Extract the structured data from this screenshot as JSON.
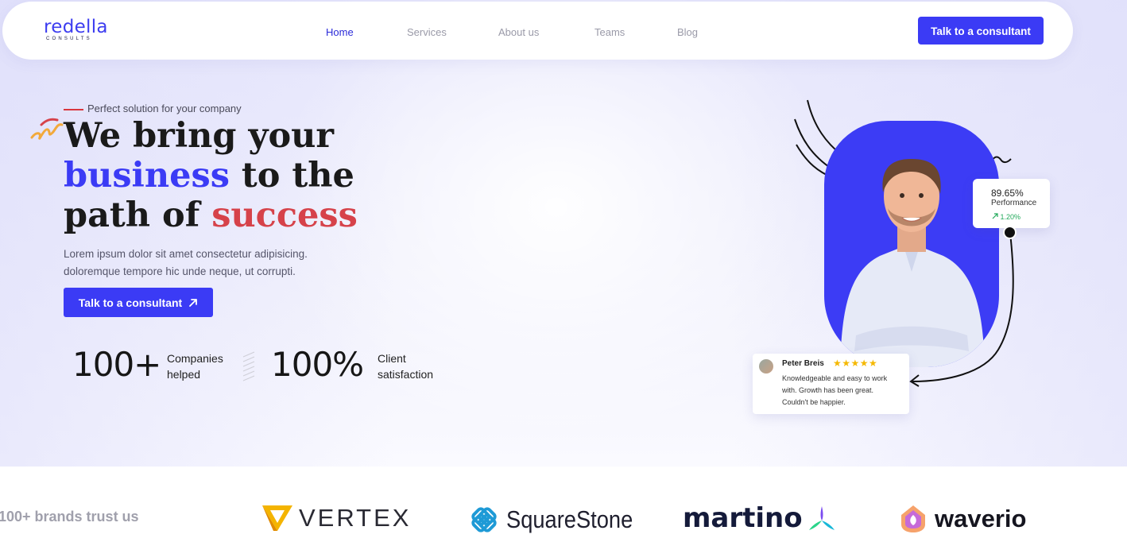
{
  "nav": {
    "logo_main": "redella",
    "logo_sub": "CONSULTS",
    "links": [
      "Home",
      "Services",
      "About us",
      "Teams",
      "Blog"
    ],
    "active": "Home",
    "cta_label": "Talk to a consultant"
  },
  "hero": {
    "tagline": "Perfect solution for your company",
    "headline_1": "We bring your",
    "headline_2_highlight": "business",
    "headline_2_rest": " to the",
    "headline_3_start": "path of ",
    "headline_3_highlight": "success",
    "description_1": "Lorem ipsum dolor sit amet consectetur adipisicing.",
    "description_2": "doloremque tempore hic unde neque, ut corrupti.",
    "cta_label": "Talk to a consultant",
    "stats": [
      {
        "number": "100+",
        "label_1": "Companies",
        "label_2": "helped"
      },
      {
        "number": "100%",
        "label_1": "Client",
        "label_2": "satisfaction"
      }
    ]
  },
  "performance_card": {
    "value": "89.65%",
    "label": "Performance",
    "change": "1.20%"
  },
  "review": {
    "name": "Peter Breis",
    "rating": 5,
    "stars": "★★★★★",
    "text": "Knowledgeable and easy to work with. Growth has been great. Couldn't be happier."
  },
  "brands": {
    "label": "100+ brands trust us",
    "items": [
      "VERTEX",
      "SquareStone",
      "martino",
      "waverio"
    ]
  },
  "colors": {
    "accent": "#3b3bf5",
    "highlight_red": "#d6424a",
    "positive": "#22a95a",
    "star": "#f5b800"
  }
}
